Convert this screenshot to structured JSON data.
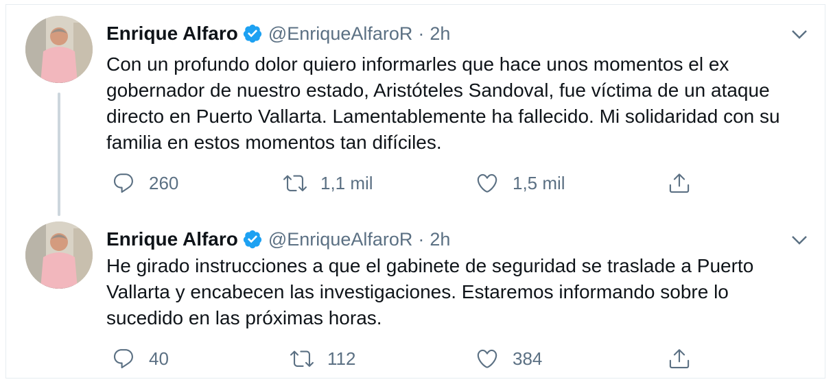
{
  "tweets": [
    {
      "author_name": "Enrique Alfaro",
      "handle": "@EnriqueAlfaroR",
      "separator": "·",
      "time": "2h",
      "text": "Con un profundo dolor quiero informarles que hace unos momentos el ex gobernador de nuestro estado, Aristóteles Sandoval, fue víctima de un ataque directo en Puerto Vallarta. Lamentablemente ha fallecido. Mi solidaridad con su familia en estos momentos tan difíciles.",
      "replies": "260",
      "retweets": "1,1 mil",
      "likes": "1,5 mil"
    },
    {
      "author_name": "Enrique Alfaro",
      "handle": "@EnriqueAlfaroR",
      "separator": "·",
      "time": "2h",
      "text": "He girado instrucciones a que el gabinete de seguridad se traslade a Puerto Vallarta y encabecen las investigaciones. Estaremos informando sobre lo sucedido en las próximas horas.",
      "replies": "40",
      "retweets": "112",
      "likes": "384"
    }
  ],
  "icons": {
    "reply": "reply-icon",
    "retweet": "retweet-icon",
    "like": "like-icon",
    "share": "share-icon",
    "verified": "verified-badge-icon",
    "caret": "chevron-down-icon"
  },
  "colors": {
    "text": "#0f1419",
    "secondary": "#5b7083",
    "verified": "#1da1f2",
    "border": "#e6ecf0",
    "thread_line": "#ccd6dd"
  }
}
